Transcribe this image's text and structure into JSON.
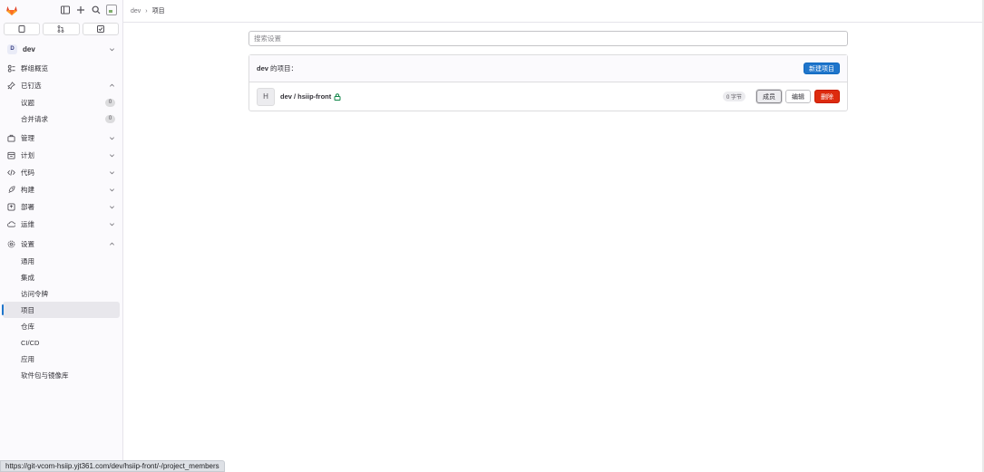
{
  "sidebar": {
    "context": {
      "avatar": "D",
      "name": "dev"
    },
    "items": [
      {
        "label": "群组概览",
        "icon": "group-overview-icon"
      },
      {
        "label": "已钉选",
        "icon": "pin-icon",
        "expanded": true
      },
      {
        "label": "管理",
        "icon": "manage-icon"
      },
      {
        "label": "计划",
        "icon": "plan-icon"
      },
      {
        "label": "代码",
        "icon": "code-icon"
      },
      {
        "label": "构建",
        "icon": "rocket-icon"
      },
      {
        "label": "部署",
        "icon": "deploy-icon"
      },
      {
        "label": "运维",
        "icon": "operate-icon"
      },
      {
        "label": "设置",
        "icon": "settings-icon",
        "expanded": true
      }
    ],
    "pinned": [
      {
        "label": "议题",
        "count": "0"
      },
      {
        "label": "合并请求",
        "count": "0"
      }
    ],
    "settings": [
      {
        "label": "通用"
      },
      {
        "label": "集成"
      },
      {
        "label": "访问令牌"
      },
      {
        "label": "项目",
        "active": true
      },
      {
        "label": "仓库"
      },
      {
        "label": "CI/CD"
      },
      {
        "label": "应用"
      },
      {
        "label": "软件包与镜像库"
      }
    ]
  },
  "breadcrumb": {
    "parent": "dev",
    "current": "项目"
  },
  "search": {
    "placeholder": "搜索设置"
  },
  "panel": {
    "owner": "dev",
    "title_suffix": "的项目：",
    "new_button": "新建项目",
    "projects": [
      {
        "avatar": "H",
        "name": "dev / hsiip-front",
        "size": "0 字节",
        "actions": {
          "members": "成员",
          "edit": "编辑",
          "delete": "删除"
        }
      }
    ]
  },
  "status_bar": {
    "url": "https://git-vcom-hsiip.yjt361.com/dev/hsiip-front/-/project_members"
  },
  "colors": {
    "primary": "#1f75cb",
    "danger": "#dd2b0e",
    "lock": "#108548",
    "logo": "#e24329"
  }
}
